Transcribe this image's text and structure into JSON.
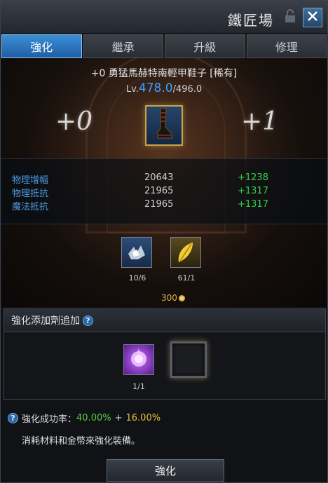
{
  "window": {
    "title": "鐵匠場"
  },
  "tabs": [
    {
      "label": "強化",
      "active": true
    },
    {
      "label": "繼承",
      "active": false
    },
    {
      "label": "升級",
      "active": false
    },
    {
      "label": "修理",
      "active": false
    }
  ],
  "item": {
    "name": "+0 勇猛馬赫特南輕甲鞋子 [稀有]",
    "level_prefix": "Lv.",
    "level_current": "478.0",
    "level_max": "/496.0",
    "plus_from": "+0",
    "plus_to": "+1",
    "icon": "boot-icon"
  },
  "stats": [
    {
      "label": "物理增幅",
      "value": "20643",
      "delta": "+1238"
    },
    {
      "label": "物理抵抗",
      "value": "21965",
      "delta": "+1317"
    },
    {
      "label": "魔法抵抗",
      "value": "21965",
      "delta": "+1317"
    }
  ],
  "materials": [
    {
      "icon": "crystal-shards-icon",
      "count": "10/6"
    },
    {
      "icon": "golden-feather-icon",
      "count": "61/1"
    }
  ],
  "cost": {
    "gold": "300"
  },
  "additive": {
    "header": "強化添加劑追加",
    "item_icon": "purple-orb-icon",
    "item_count": "1/1"
  },
  "info": {
    "rate_label": "強化成功率：",
    "rate_base": "40.00%",
    "plus": "+",
    "rate_bonus": "16.00%",
    "description": "消耗材料和金幣來強化裝備。"
  },
  "actions": {
    "enhance_label": "強化"
  },
  "colors": {
    "accent_blue": "#3fa0ff",
    "stat_label": "#4c9ee6",
    "delta_green": "#33d24a",
    "rate_green": "#57cc3e",
    "rate_bonus": "#e1c13a",
    "gold": "#e3b04a"
  }
}
